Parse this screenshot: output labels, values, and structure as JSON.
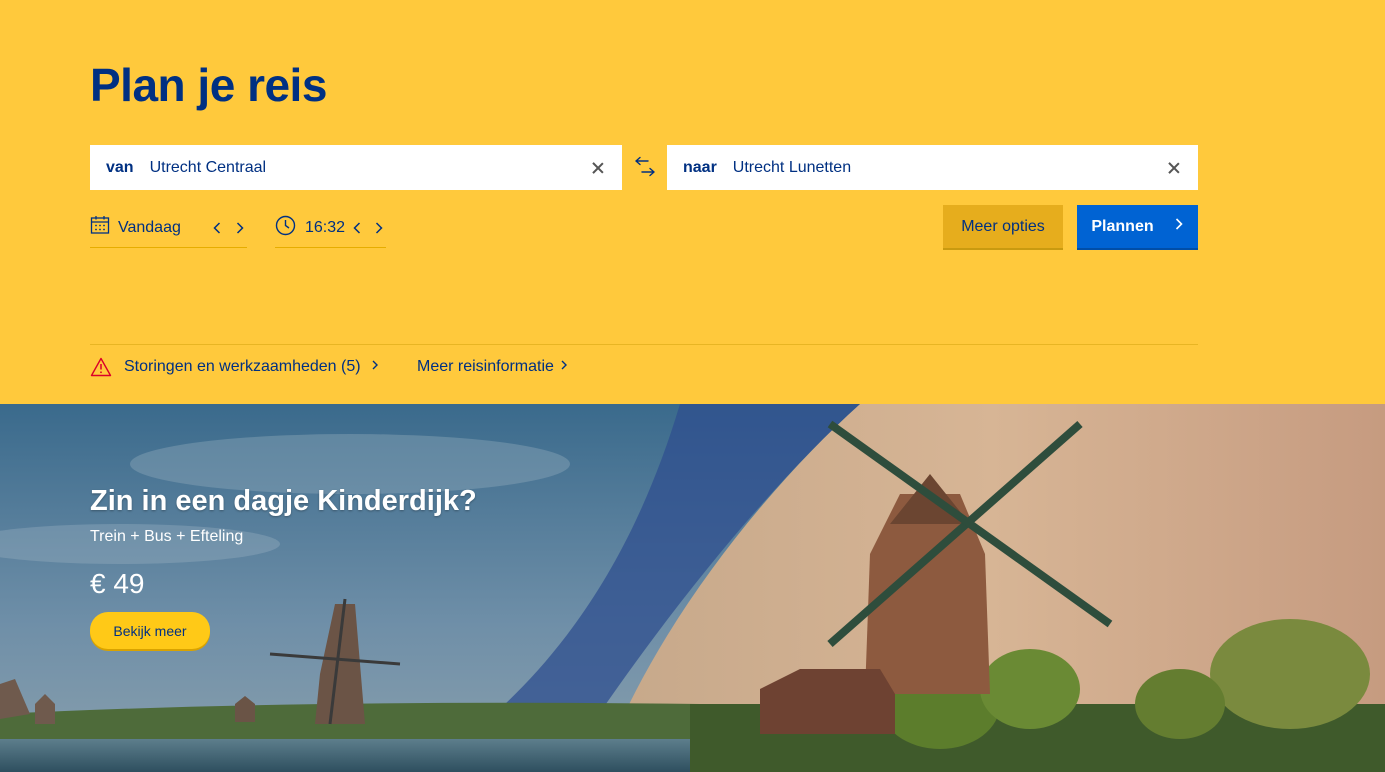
{
  "planner": {
    "title": "Plan je reis",
    "from": {
      "label": "van",
      "value": "Utrecht Centraal"
    },
    "to": {
      "label": "naar",
      "value": "Utrecht Lunetten"
    },
    "date": "Vandaag",
    "time": "16:32",
    "more_options": "Meer opties",
    "plan_button": "Plannen"
  },
  "links": {
    "disruptions": "Storingen en werkzaamheden (5)",
    "travel_info": "Meer reisinformatie"
  },
  "promo": {
    "title": "Zin in een dagje Kinderdijk?",
    "subtitle": "Trein + Bus + Efteling",
    "price": "€ 49",
    "button": "Bekijk meer"
  },
  "colors": {
    "brand_yellow": "#ffc93c",
    "brand_blue": "#003082",
    "button_blue": "#0063d3",
    "warning_red": "#db0029"
  },
  "icons": [
    "clear-icon",
    "swap-icon",
    "calendar-icon",
    "clock-icon",
    "chevron-left-icon",
    "chevron-right-icon",
    "warning-icon"
  ]
}
